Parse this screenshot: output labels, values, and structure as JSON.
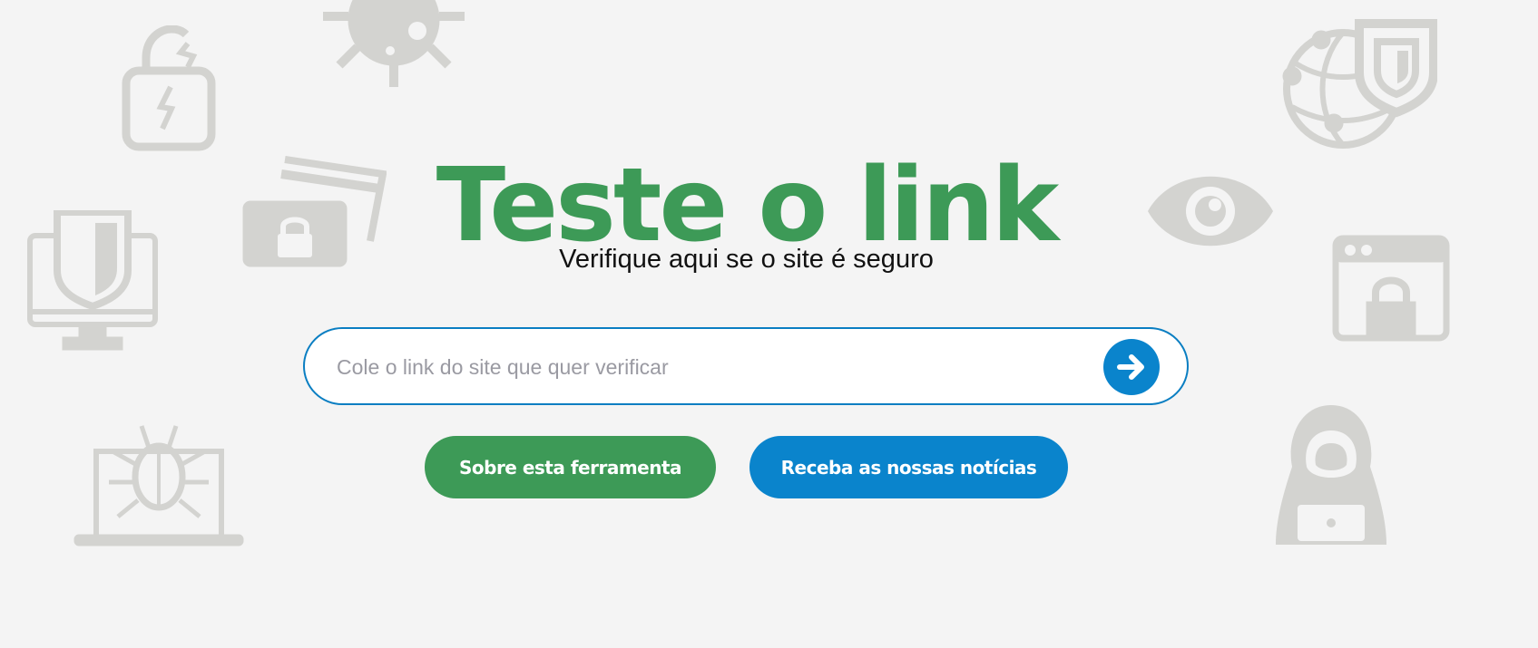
{
  "hero": {
    "title": "Teste o link",
    "subtitle": "Verifique aqui se o site é seguro"
  },
  "search": {
    "placeholder": "Cole o link do site que quer verificar",
    "value": "",
    "submit_icon": "arrow-right-icon"
  },
  "buttons": {
    "about_label": "Sobre esta ferramenta",
    "news_label": "Receba as nossas notícias"
  },
  "colors": {
    "brand_green": "#3d9a57",
    "brand_blue": "#0a84cc",
    "background": "#f4f4f4",
    "decor_gray": "#d3d3d0"
  },
  "background_icons": [
    "broken-padlock-icon",
    "virus-icon",
    "credit-card-lock-icon",
    "shield-monitor-icon",
    "bug-laptop-icon",
    "globe-shield-icon",
    "eye-icon",
    "browser-lock-icon",
    "hacker-icon"
  ]
}
